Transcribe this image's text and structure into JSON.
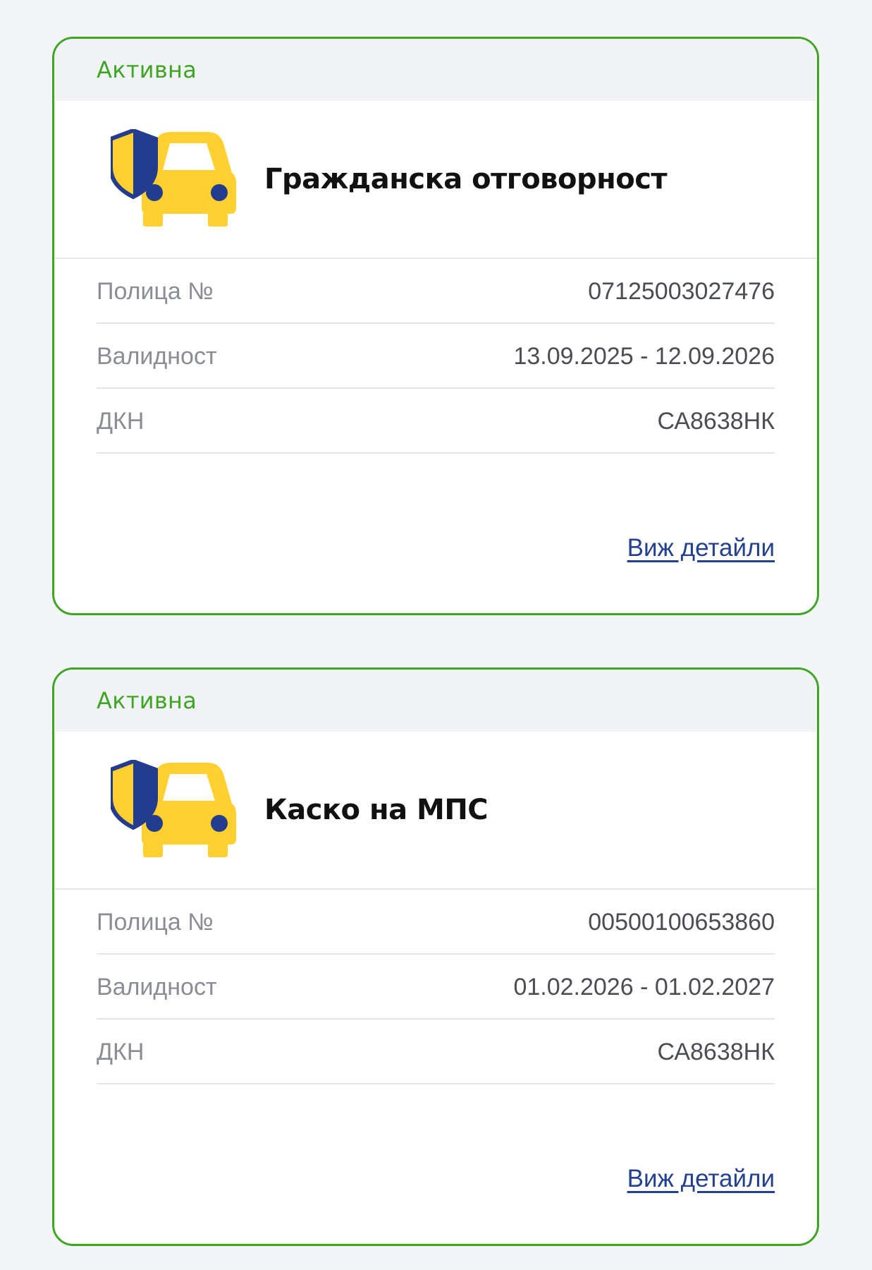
{
  "policies": [
    {
      "status": "Активна",
      "title": "Гражданска отговорност",
      "icon": "car-shield-icon",
      "rows": [
        {
          "label": "Полица №",
          "value": "07125003027476"
        },
        {
          "label": "Валидност",
          "value": "13.09.2025 - 12.09.2026"
        },
        {
          "label": "ДКН",
          "value": "СА8638НК"
        }
      ],
      "link_label": "Виж детайли"
    },
    {
      "status": "Активна",
      "title": "Каско на МПС",
      "icon": "car-shield-icon",
      "rows": [
        {
          "label": "Полица №",
          "value": "00500100653860"
        },
        {
          "label": "Валидност",
          "value": "01.02.2026 - 01.02.2027"
        },
        {
          "label": "ДКН",
          "value": "СА8638НК"
        }
      ],
      "link_label": "Виж детайли"
    }
  ],
  "colors": {
    "active_status": "#3fa524",
    "card_border": "#3fa524",
    "link": "#24418f",
    "icon_car": "#ffd02f",
    "icon_shield": "#233c8d",
    "page_background": "#f4f5f7"
  }
}
